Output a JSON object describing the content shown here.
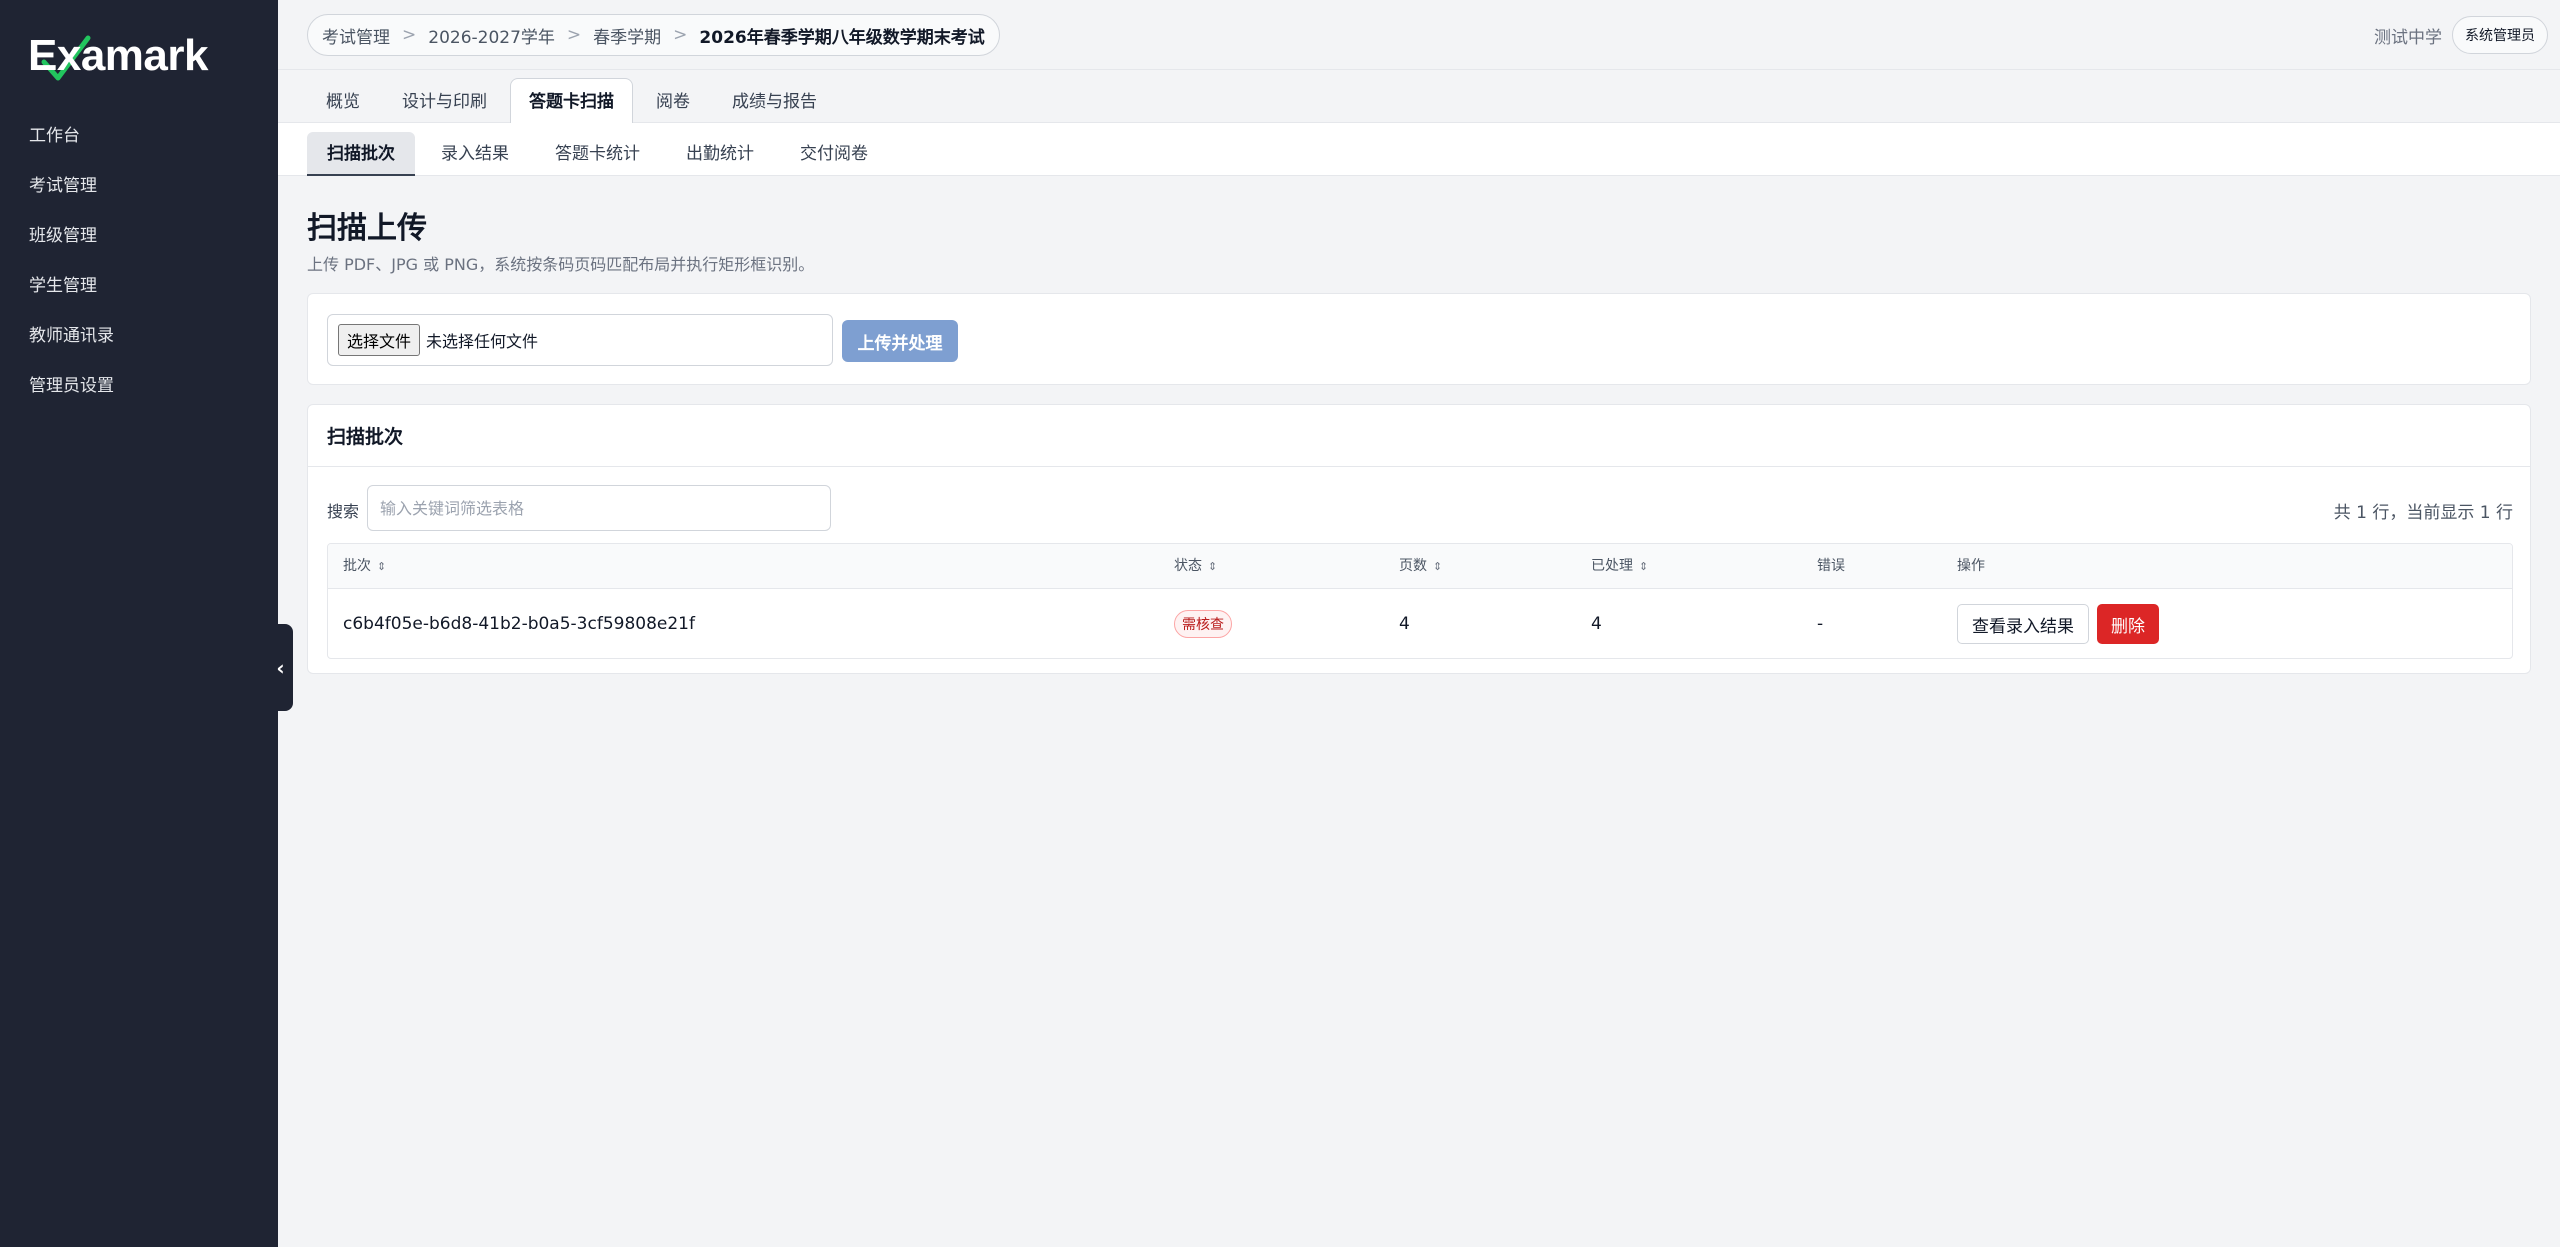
{
  "app": {
    "logo_text": "Examark"
  },
  "sidebar": {
    "items": [
      {
        "label": "工作台"
      },
      {
        "label": "考试管理"
      },
      {
        "label": "班级管理"
      },
      {
        "label": "学生管理"
      },
      {
        "label": "教师通讯录"
      },
      {
        "label": "管理员设置"
      }
    ],
    "collapse_glyph": "‹"
  },
  "topbar": {
    "breadcrumb": [
      "考试管理",
      "2026-2027学年",
      "春季学期",
      "2026年春季学期八年级数学期末考试"
    ],
    "separator": ">",
    "school": "测试中学",
    "role": "系统管理员"
  },
  "tabs": [
    {
      "label": "概览"
    },
    {
      "label": "设计与印刷"
    },
    {
      "label": "答题卡扫描"
    },
    {
      "label": "阅卷"
    },
    {
      "label": "成绩与报告"
    }
  ],
  "subtabs": [
    {
      "label": "扫描批次"
    },
    {
      "label": "录入结果"
    },
    {
      "label": "答题卡统计"
    },
    {
      "label": "出勤统计"
    },
    {
      "label": "交付阅卷"
    }
  ],
  "page": {
    "title": "扫描上传",
    "description": "上传 PDF、JPG 或 PNG，系统按条码页码匹配布局并执行矩形框识别。"
  },
  "upload": {
    "choose_label": "选择文件",
    "file_status": "未选择任何文件",
    "submit_label": "上传并处理"
  },
  "batches": {
    "title": "扫描批次",
    "search_label": "搜索",
    "search_placeholder": "输入关键词筛选表格",
    "row_count": "共 1 行，当前显示 1 行",
    "columns": {
      "batch": "批次",
      "status": "状态",
      "pages": "页数",
      "processed": "已处理",
      "errors": "错误",
      "actions": "操作"
    },
    "rows": [
      {
        "batch": "c6b4f05e-b6d8-41b2-b0a5-3cf59808e21f",
        "status": "需核查",
        "pages": "4",
        "processed": "4",
        "errors": "-",
        "view_label": "查看录入结果",
        "delete_label": "删除"
      }
    ]
  },
  "colors": {
    "sidebar_bg": "#1f2433",
    "accent_disabled": "#7e9fd1",
    "danger": "#dc2626",
    "status_warning": "#b91c1c"
  }
}
